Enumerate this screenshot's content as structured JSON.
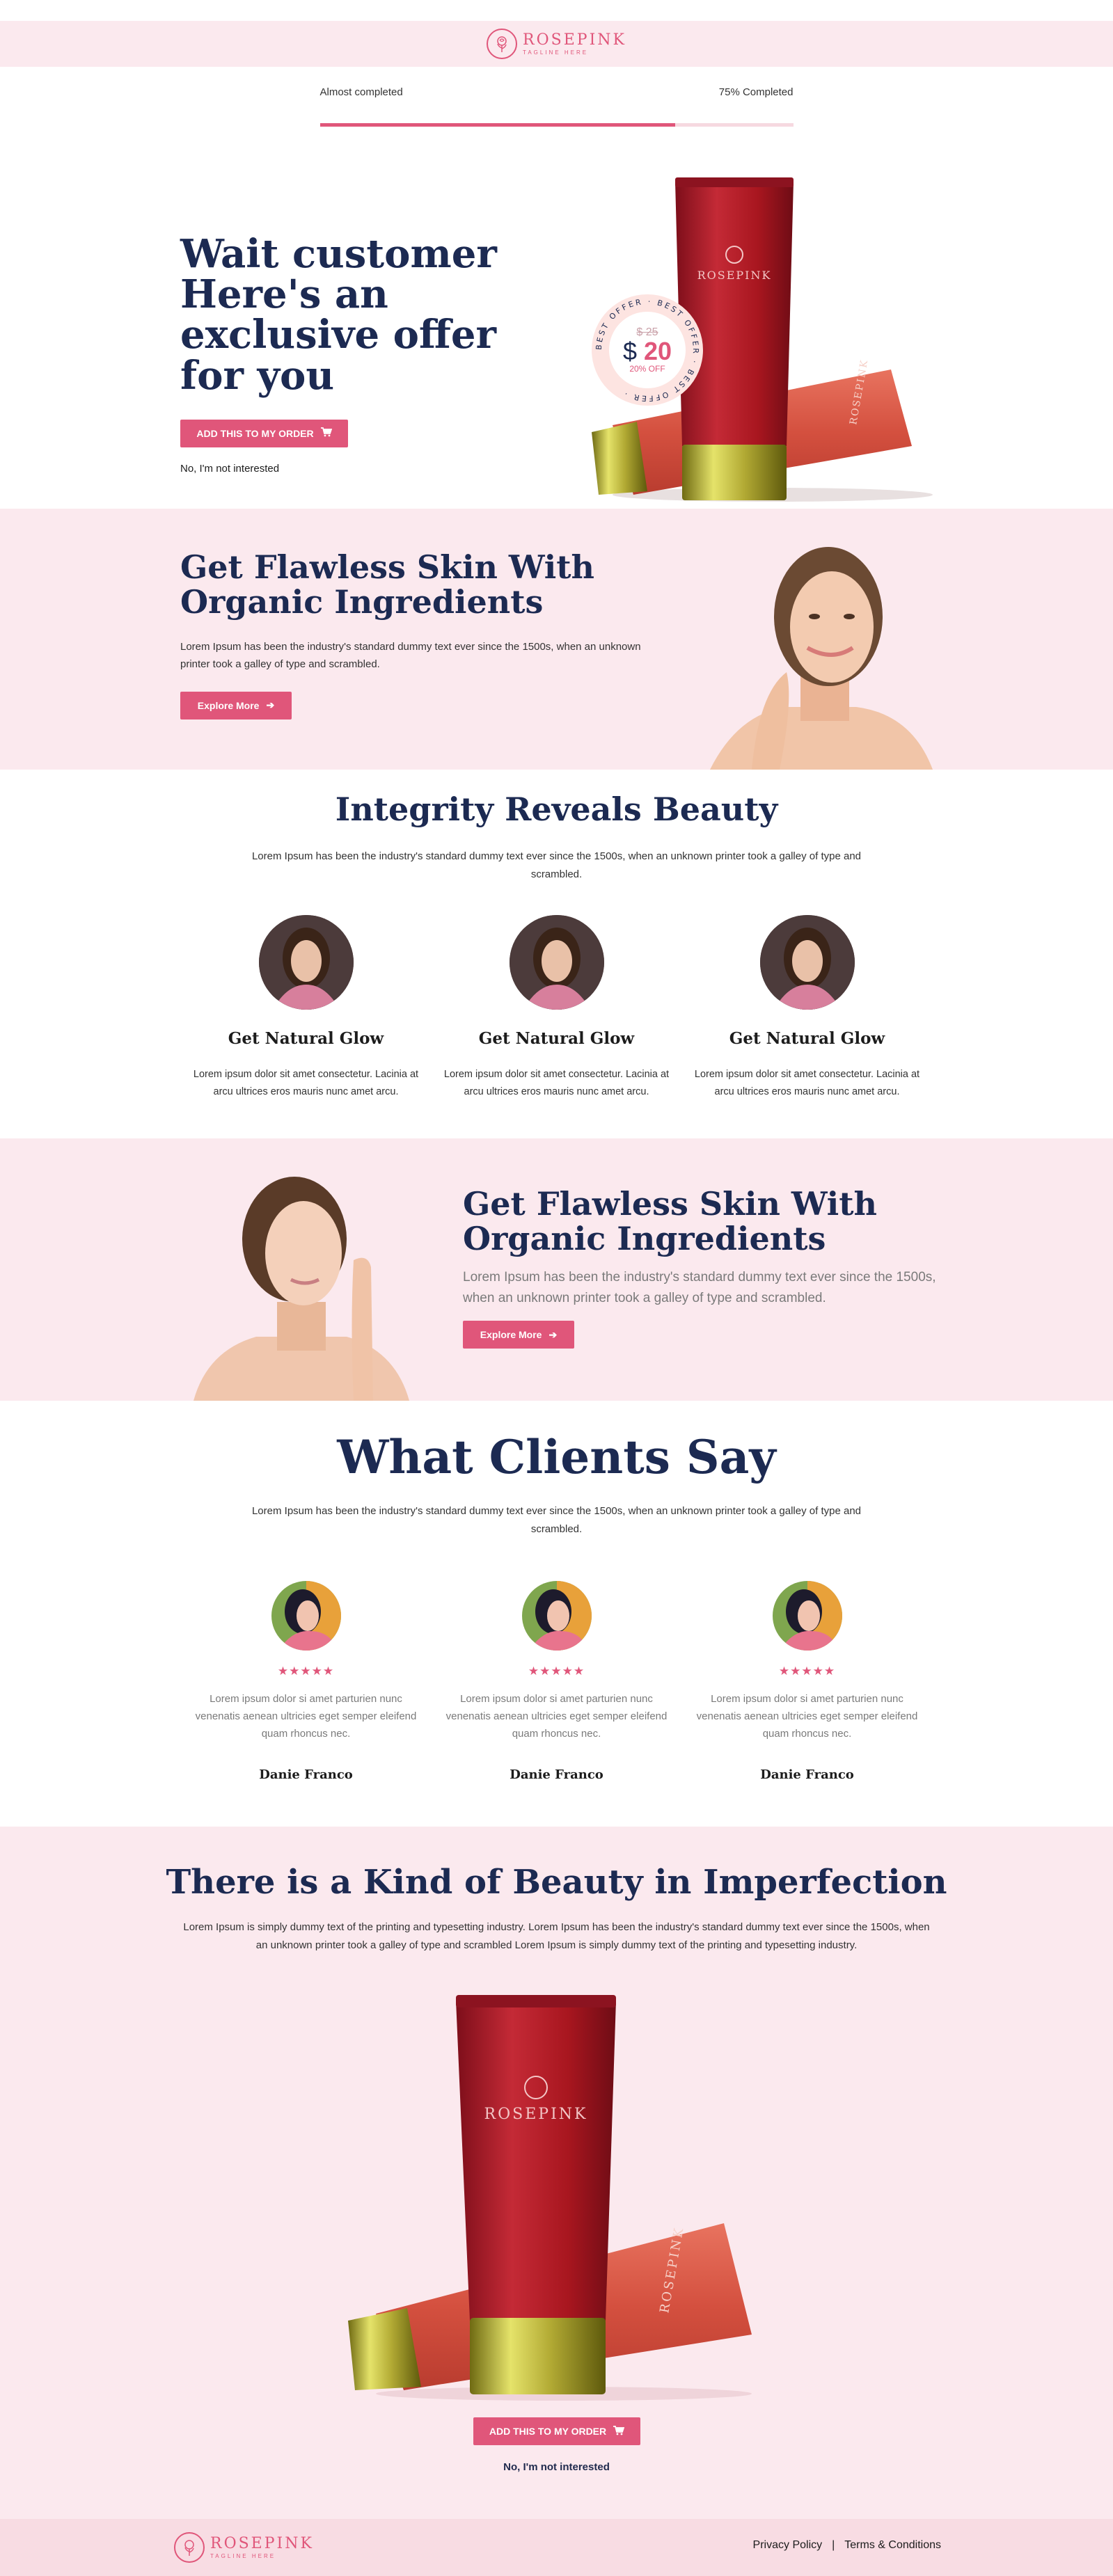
{
  "brand": {
    "name": "ROSEPINK",
    "tagline": "TAGLINE HERE"
  },
  "progress": {
    "left_label": "Almost completed",
    "right_label": "75% Completed",
    "fraction": 0.75
  },
  "hero": {
    "title": "Wait customer Here's an exclusive offer for you",
    "cta": "ADD THIS TO MY ORDER",
    "decline": "No, I'm not interested",
    "badge": {
      "ring_text": "BEST OFFER · BEST OFFER · BEST OFFER ·",
      "old_price": "$ 25",
      "currency": "$",
      "price": "20",
      "discount": "20% OFF"
    }
  },
  "flawless_1": {
    "title": "Get Flawless Skin With Organic Ingredients",
    "text": "Lorem Ipsum has been the industry's standard dummy text ever since the 1500s, when an unknown printer took a galley of type and scrambled.",
    "cta": "Explore More"
  },
  "integrity": {
    "title": "Integrity Reveals Beauty",
    "text": "Lorem Ipsum has been the industry's standard dummy text ever since the 1500s, when an unknown printer took a galley of type and scrambled.",
    "features": [
      {
        "title": "Get Natural Glow",
        "text": "Lorem ipsum dolor sit amet consectetur. Lacinia at arcu ultrices eros mauris nunc amet arcu."
      },
      {
        "title": "Get Natural Glow",
        "text": "Lorem ipsum dolor sit amet consectetur. Lacinia at arcu ultrices eros mauris nunc amet arcu."
      },
      {
        "title": "Get Natural Glow",
        "text": "Lorem ipsum dolor sit amet consectetur. Lacinia at arcu ultrices eros mauris nunc amet arcu."
      }
    ]
  },
  "flawless_2": {
    "title": "Get Flawless Skin With Organic Ingredients",
    "text": "Lorem Ipsum has been the industry's standard dummy text ever since the 1500s, when an unknown printer took a galley of type and scrambled.",
    "cta": "Explore More"
  },
  "clients": {
    "title": "What Clients Say",
    "text": "Lorem Ipsum has been the industry's standard dummy text ever since the 1500s, when an unknown printer took a galley of type and scrambled.",
    "items": [
      {
        "stars": "★★★★★",
        "text": "Lorem ipsum dolor si amet parturien nunc venenatis aenean ultricies eget semper eleifend quam rhoncus nec.",
        "name": "Danie Franco"
      },
      {
        "stars": "★★★★★",
        "text": "Lorem ipsum dolor si amet parturien nunc venenatis aenean ultricies eget semper eleifend quam rhoncus nec.",
        "name": "Danie Franco"
      },
      {
        "stars": "★★★★★",
        "text": "Lorem ipsum dolor si amet parturien nunc venenatis aenean ultricies eget semper eleifend quam rhoncus nec.",
        "name": "Danie Franco"
      }
    ]
  },
  "imperfection": {
    "title": "There is a Kind of Beauty in Imperfection",
    "text": "Lorem Ipsum is simply dummy text of the printing and typesetting industry. Lorem Ipsum has been the industry's standard dummy text ever since the 1500s, when an unknown printer took a galley of type and scrambled Lorem Ipsum is simply dummy text of the printing and typesetting industry.",
    "cta": "ADD THIS TO MY ORDER",
    "decline": "No, I'm not interested"
  },
  "footer": {
    "privacy": "Privacy Policy",
    "separator": "|",
    "terms": "Terms & Conditions"
  },
  "colors": {
    "accent": "#e0567a",
    "navy": "#1c2a52",
    "pink_bg": "#fbe9ee",
    "footer_bg": "#f8dce3"
  }
}
